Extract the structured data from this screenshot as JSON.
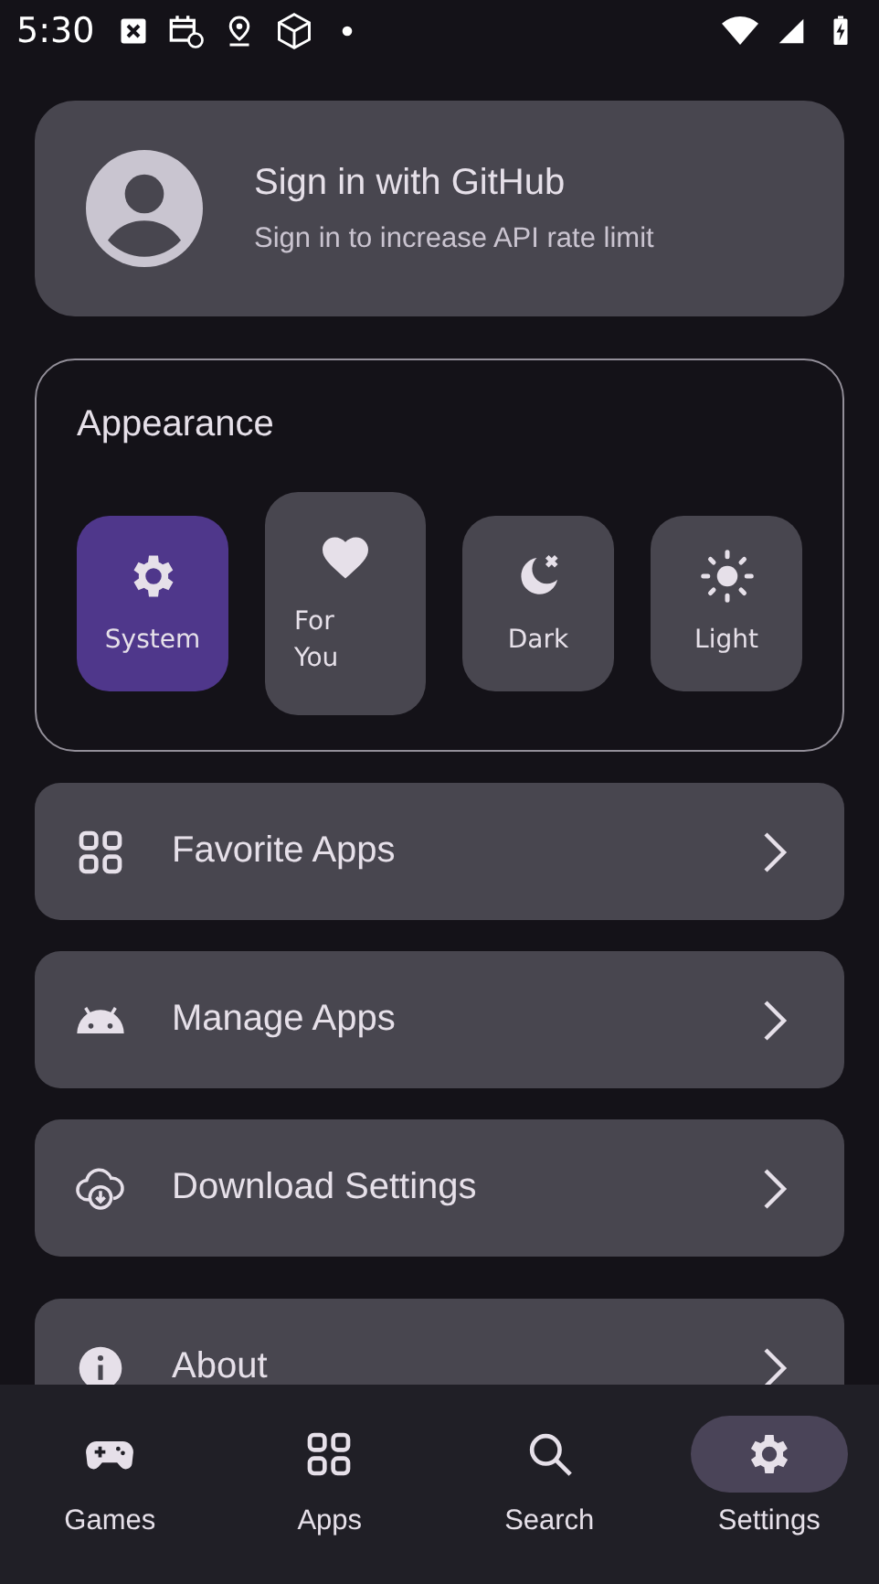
{
  "status_bar": {
    "time": "5:30"
  },
  "account": {
    "title": "Sign in with GitHub",
    "subtitle": "Sign in to increase API rate limit"
  },
  "appearance": {
    "title": "Appearance",
    "options": [
      {
        "kind": "system",
        "label": "System",
        "selected": true,
        "pressed": false
      },
      {
        "kind": "foryou",
        "label": "For\nYou",
        "selected": false,
        "pressed": true
      },
      {
        "kind": "dark",
        "label": "Dark",
        "selected": false,
        "pressed": false
      },
      {
        "kind": "light",
        "label": "Light",
        "selected": false,
        "pressed": false
      }
    ]
  },
  "menu": [
    {
      "kind": "favorites",
      "label": "Favorite Apps"
    },
    {
      "kind": "manage",
      "label": "Manage Apps"
    },
    {
      "kind": "download",
      "label": "Download Settings"
    },
    {
      "kind": "about",
      "label": "About"
    }
  ],
  "nav": [
    {
      "kind": "games",
      "label": "Games",
      "selected": false
    },
    {
      "kind": "apps",
      "label": "Apps",
      "selected": false
    },
    {
      "kind": "search",
      "label": "Search",
      "selected": false
    },
    {
      "kind": "settings",
      "label": "Settings",
      "selected": true
    }
  ]
}
